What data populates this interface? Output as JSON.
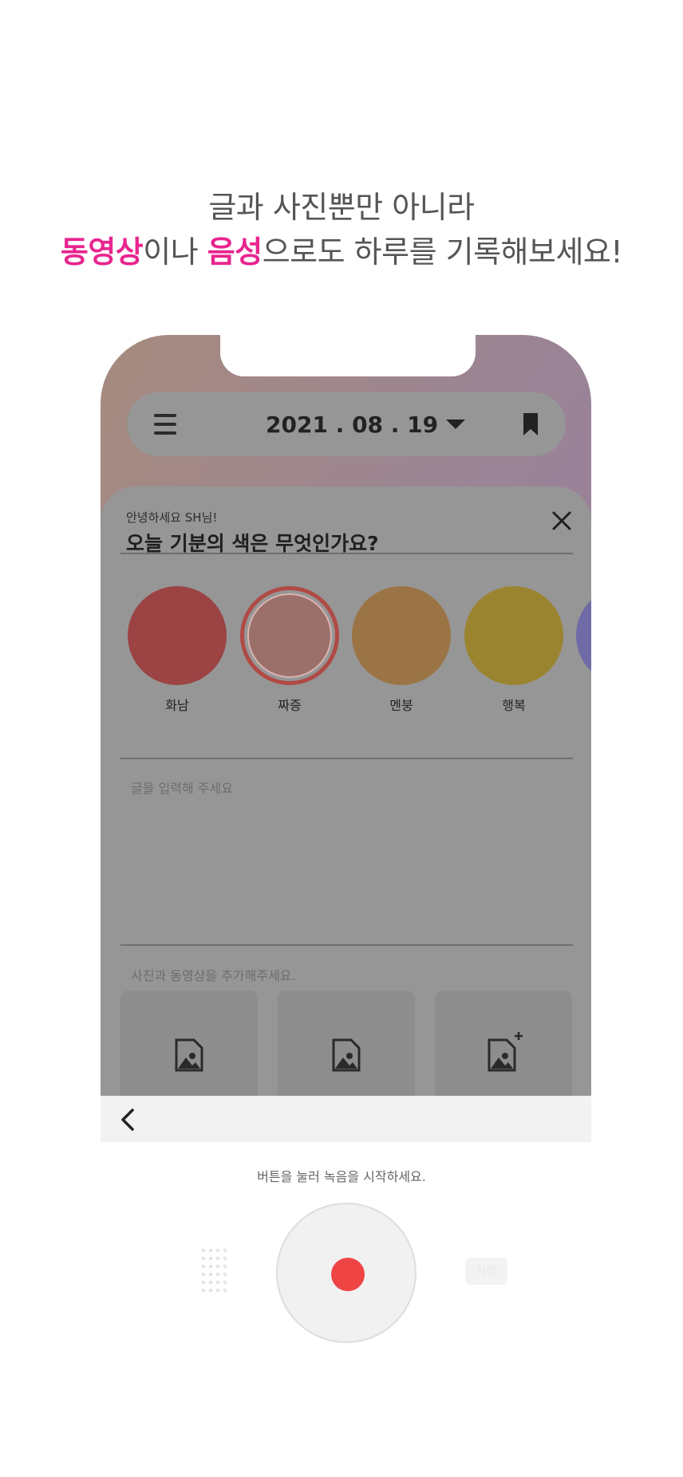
{
  "headline": {
    "line1": "글과 사진뿐만 아니라",
    "accent1": "동영상",
    "mid1": "이나 ",
    "accent2": "음성",
    "rest": "으로도 하루를 기록해보세요!"
  },
  "topbar": {
    "menu_icon": "hamburger-icon",
    "date": "2021 . 08 . 19",
    "date_caret_icon": "caret-down-icon",
    "bookmark_icon": "bookmark-icon"
  },
  "sheet": {
    "greeting": "안녕하세요 SH님!",
    "question": "오늘 기분의 색은 무엇인가요?",
    "close_icon": "close-icon",
    "moods": [
      {
        "label": "화남",
        "color": "#9c4343",
        "selected": false
      },
      {
        "label": "짜증",
        "color": "#9b706b",
        "selected": true
      },
      {
        "label": "멘붕",
        "color": "#9b7446",
        "selected": false
      },
      {
        "label": "행복",
        "color": "#9b8430",
        "selected": false
      },
      {
        "label": "",
        "color": "#6e6ba6",
        "selected": false
      }
    ],
    "text_placeholder": "글을 입력해 주세요",
    "media_hint": "사진과 동영상을 추가해주세요.",
    "media_tiles": [
      "image-icon",
      "image-icon",
      "image-add-icon"
    ]
  },
  "recorder": {
    "back_icon": "chevron-left-icon",
    "hint": "버튼을 눌러 녹음을 시작하세요.",
    "record_color": "#ef4444",
    "save_label": "저장"
  },
  "colors": {
    "accent": "#e8258f",
    "gradient_start": "#a68b7e",
    "gradient_end": "#9779a3"
  }
}
